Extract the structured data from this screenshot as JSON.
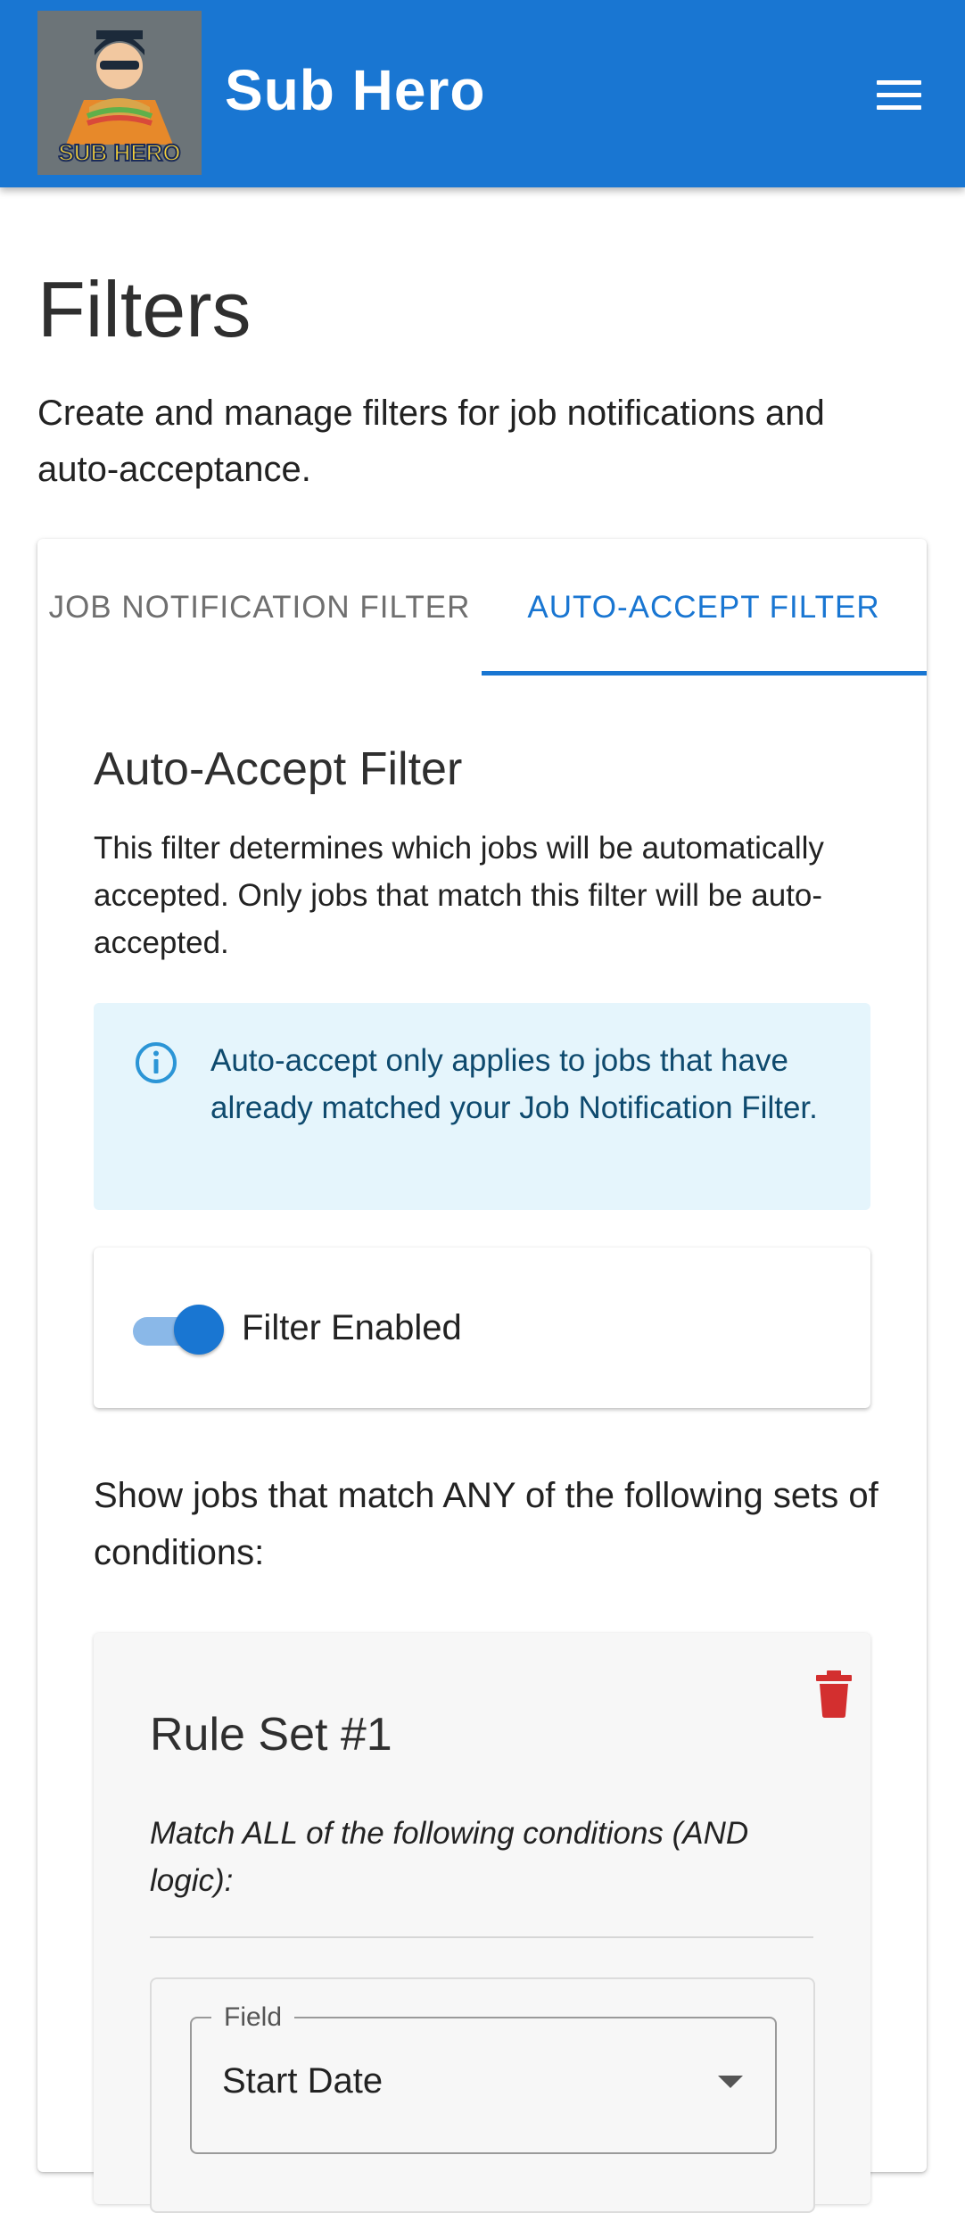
{
  "app": {
    "title": "Sub Hero",
    "logo_text": "SUB HERO"
  },
  "page": {
    "title": "Filters",
    "description": "Create and manage filters for job notifications and auto-acceptance."
  },
  "tabs": [
    {
      "label": "JOB NOTIFICATION FILTER",
      "active": false
    },
    {
      "label": "AUTO-ACCEPT FILTER",
      "active": true
    }
  ],
  "auto_accept": {
    "title": "Auto-Accept Filter",
    "description": "This filter determines which jobs will be automatically accepted. Only jobs that match this filter will be auto-accepted.",
    "info": "Auto-accept only applies to jobs that have already matched your Job Notification Filter.",
    "toggle_label": "Filter Enabled",
    "toggle_on": true,
    "match_text": "Show jobs that match ANY of the following sets of conditions:"
  },
  "rule_sets": [
    {
      "title": "Rule Set #1",
      "subtitle": "Match ALL of the following conditions (AND logic):",
      "conditions": [
        {
          "field_label": "Field",
          "field_value": "Start Date"
        }
      ]
    }
  ],
  "colors": {
    "primary": "#1976d2",
    "info_bg": "#e5f5fc",
    "info_text": "#0e4a6e",
    "danger": "#d32f2f"
  },
  "icons": {
    "menu": "menu-icon",
    "info": "info-icon",
    "delete": "trash-icon",
    "dropdown": "chevron-down-icon"
  }
}
